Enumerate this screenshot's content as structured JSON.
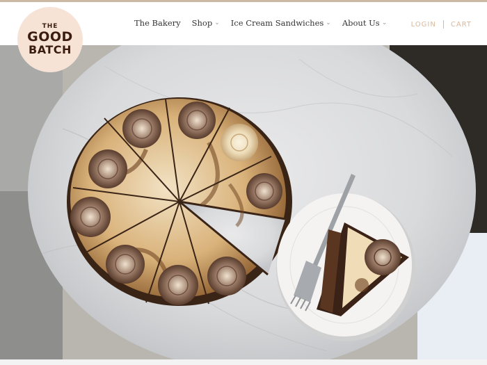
{
  "logo": {
    "line1": "THE",
    "line2": "GOOD",
    "line3": "BATCH"
  },
  "nav": {
    "items": [
      {
        "label": "The Bakery",
        "has_dropdown": false
      },
      {
        "label": "Shop",
        "has_dropdown": true
      },
      {
        "label": "Ice Cream Sandwiches",
        "has_dropdown": true
      },
      {
        "label": "About Us",
        "has_dropdown": true
      }
    ]
  },
  "account": {
    "login": "LOGIN",
    "cart": "CART"
  },
  "colors": {
    "accent": "#d9b89b",
    "logo_bg": "#f6e3d6",
    "logo_text": "#3b1d0f"
  }
}
